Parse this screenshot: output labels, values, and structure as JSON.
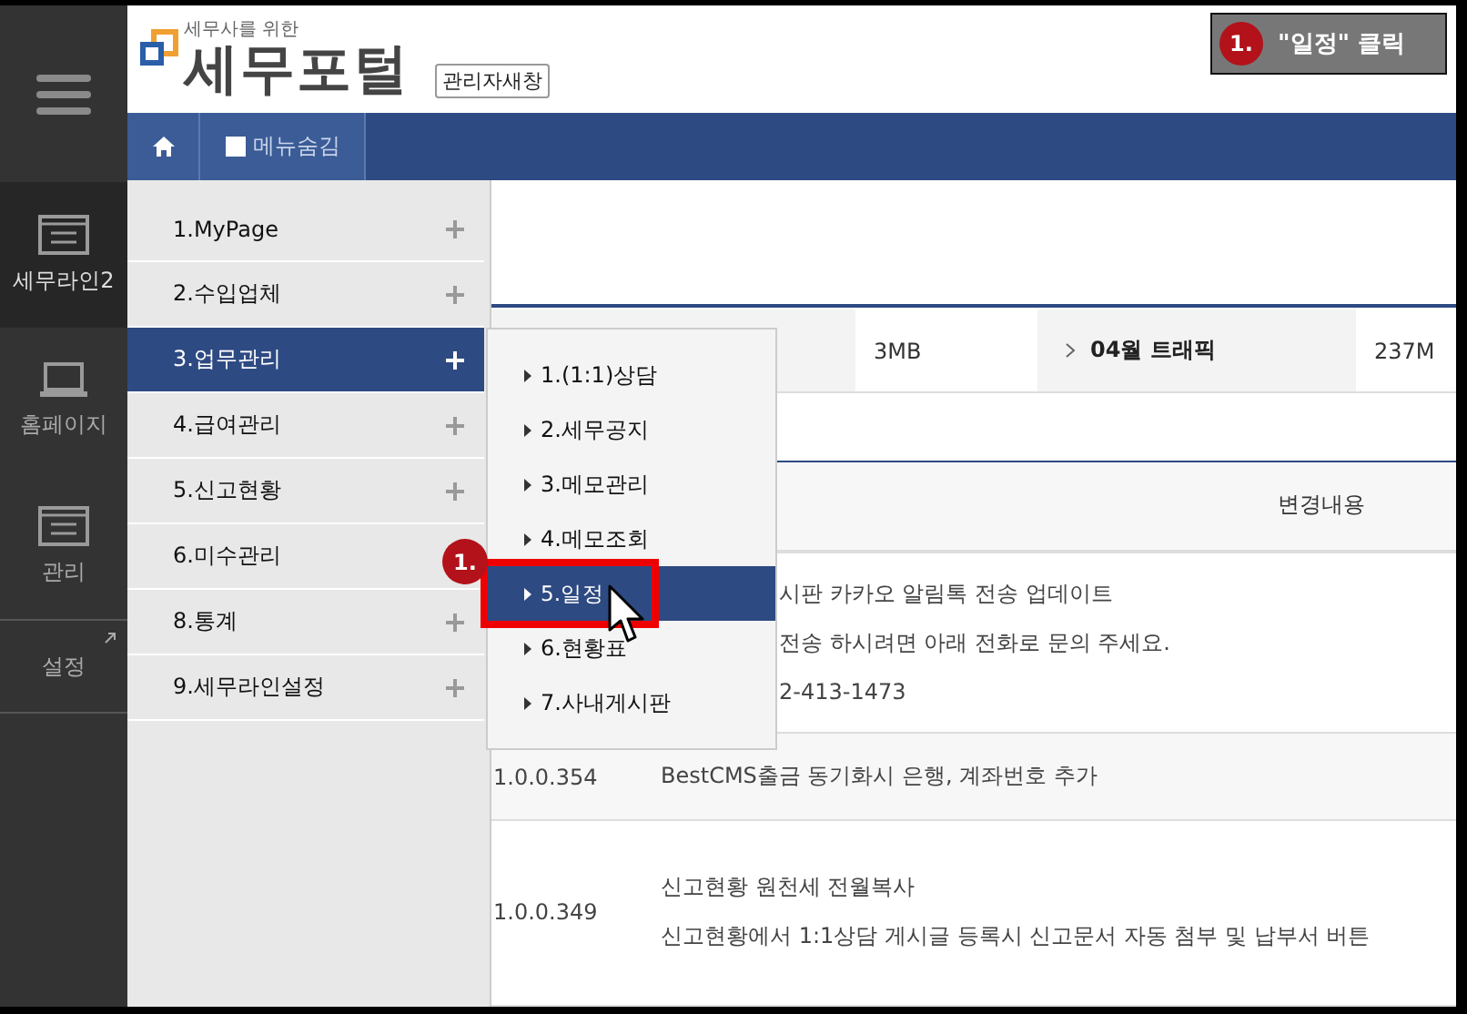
{
  "rail": {
    "items": [
      {
        "label": "세무라인2",
        "kind": "window",
        "selected": true
      },
      {
        "label": "홈페이지",
        "kind": "laptop",
        "selected": false
      },
      {
        "label": "관리",
        "kind": "window",
        "selected": false
      },
      {
        "label": "설정",
        "kind": "link",
        "selected": false
      }
    ]
  },
  "header": {
    "logo_tagline": "세무사를 위한",
    "logo_title": "세무포털",
    "admin_button": "관리자새창"
  },
  "callout": {
    "number": "1.",
    "text": "\"일정\" 클릭"
  },
  "navbar": {
    "menu_hide": {
      "label": "메뉴숨김",
      "checked": false
    }
  },
  "sidebar": {
    "items": [
      {
        "label": "1.MyPage",
        "selected": false,
        "plus_visible": true
      },
      {
        "label": "2.수입업체",
        "selected": false,
        "plus_visible": true
      },
      {
        "label": "3.업무관리",
        "selected": true,
        "plus_visible": true
      },
      {
        "label": "4.급여관리",
        "selected": false,
        "plus_visible": true
      },
      {
        "label": "5.신고현황",
        "selected": false,
        "plus_visible": true
      },
      {
        "label": "6.미수관리",
        "selected": false,
        "plus_visible": false
      },
      {
        "label": "8.통계",
        "selected": false,
        "plus_visible": true
      },
      {
        "label": "9.세무라인설정",
        "selected": false,
        "plus_visible": true
      }
    ]
  },
  "submenu": {
    "marker": "1.",
    "items": [
      {
        "label": "1.(1:1)상담",
        "selected": false
      },
      {
        "label": "2.세무공지",
        "selected": false
      },
      {
        "label": "3.메모관리",
        "selected": false
      },
      {
        "label": "4.메모조회",
        "selected": false
      },
      {
        "label": "5.일정",
        "selected": true
      },
      {
        "label": "6.현황표",
        "selected": false
      },
      {
        "label": "7.사내게시판",
        "selected": false
      }
    ]
  },
  "summary_row": {
    "size_1": "3MB",
    "traffic_label": "04월 트래픽",
    "size_2": "237M"
  },
  "table": {
    "header": "변경내용",
    "rows": [
      {
        "kind": "covered",
        "version": "",
        "lines": [
          "시판 카카오 알림톡 전송 업데이트",
          "전송 하시려면 아래 전화로 문의 주세요.",
          "2-413-1473"
        ]
      },
      {
        "kind": "plain",
        "version": "1.0.0.354",
        "lines": [
          "BestCMS출금 동기화시 은행, 계좌번호 추가"
        ]
      },
      {
        "kind": "plain",
        "version": "1.0.0.349",
        "lines": [
          "신고현황 원천세 전월복사",
          "신고현황에서 1:1상담 게시글 등록시 신고문서 자동 첨부 및 납부서 버튼"
        ]
      }
    ]
  }
}
